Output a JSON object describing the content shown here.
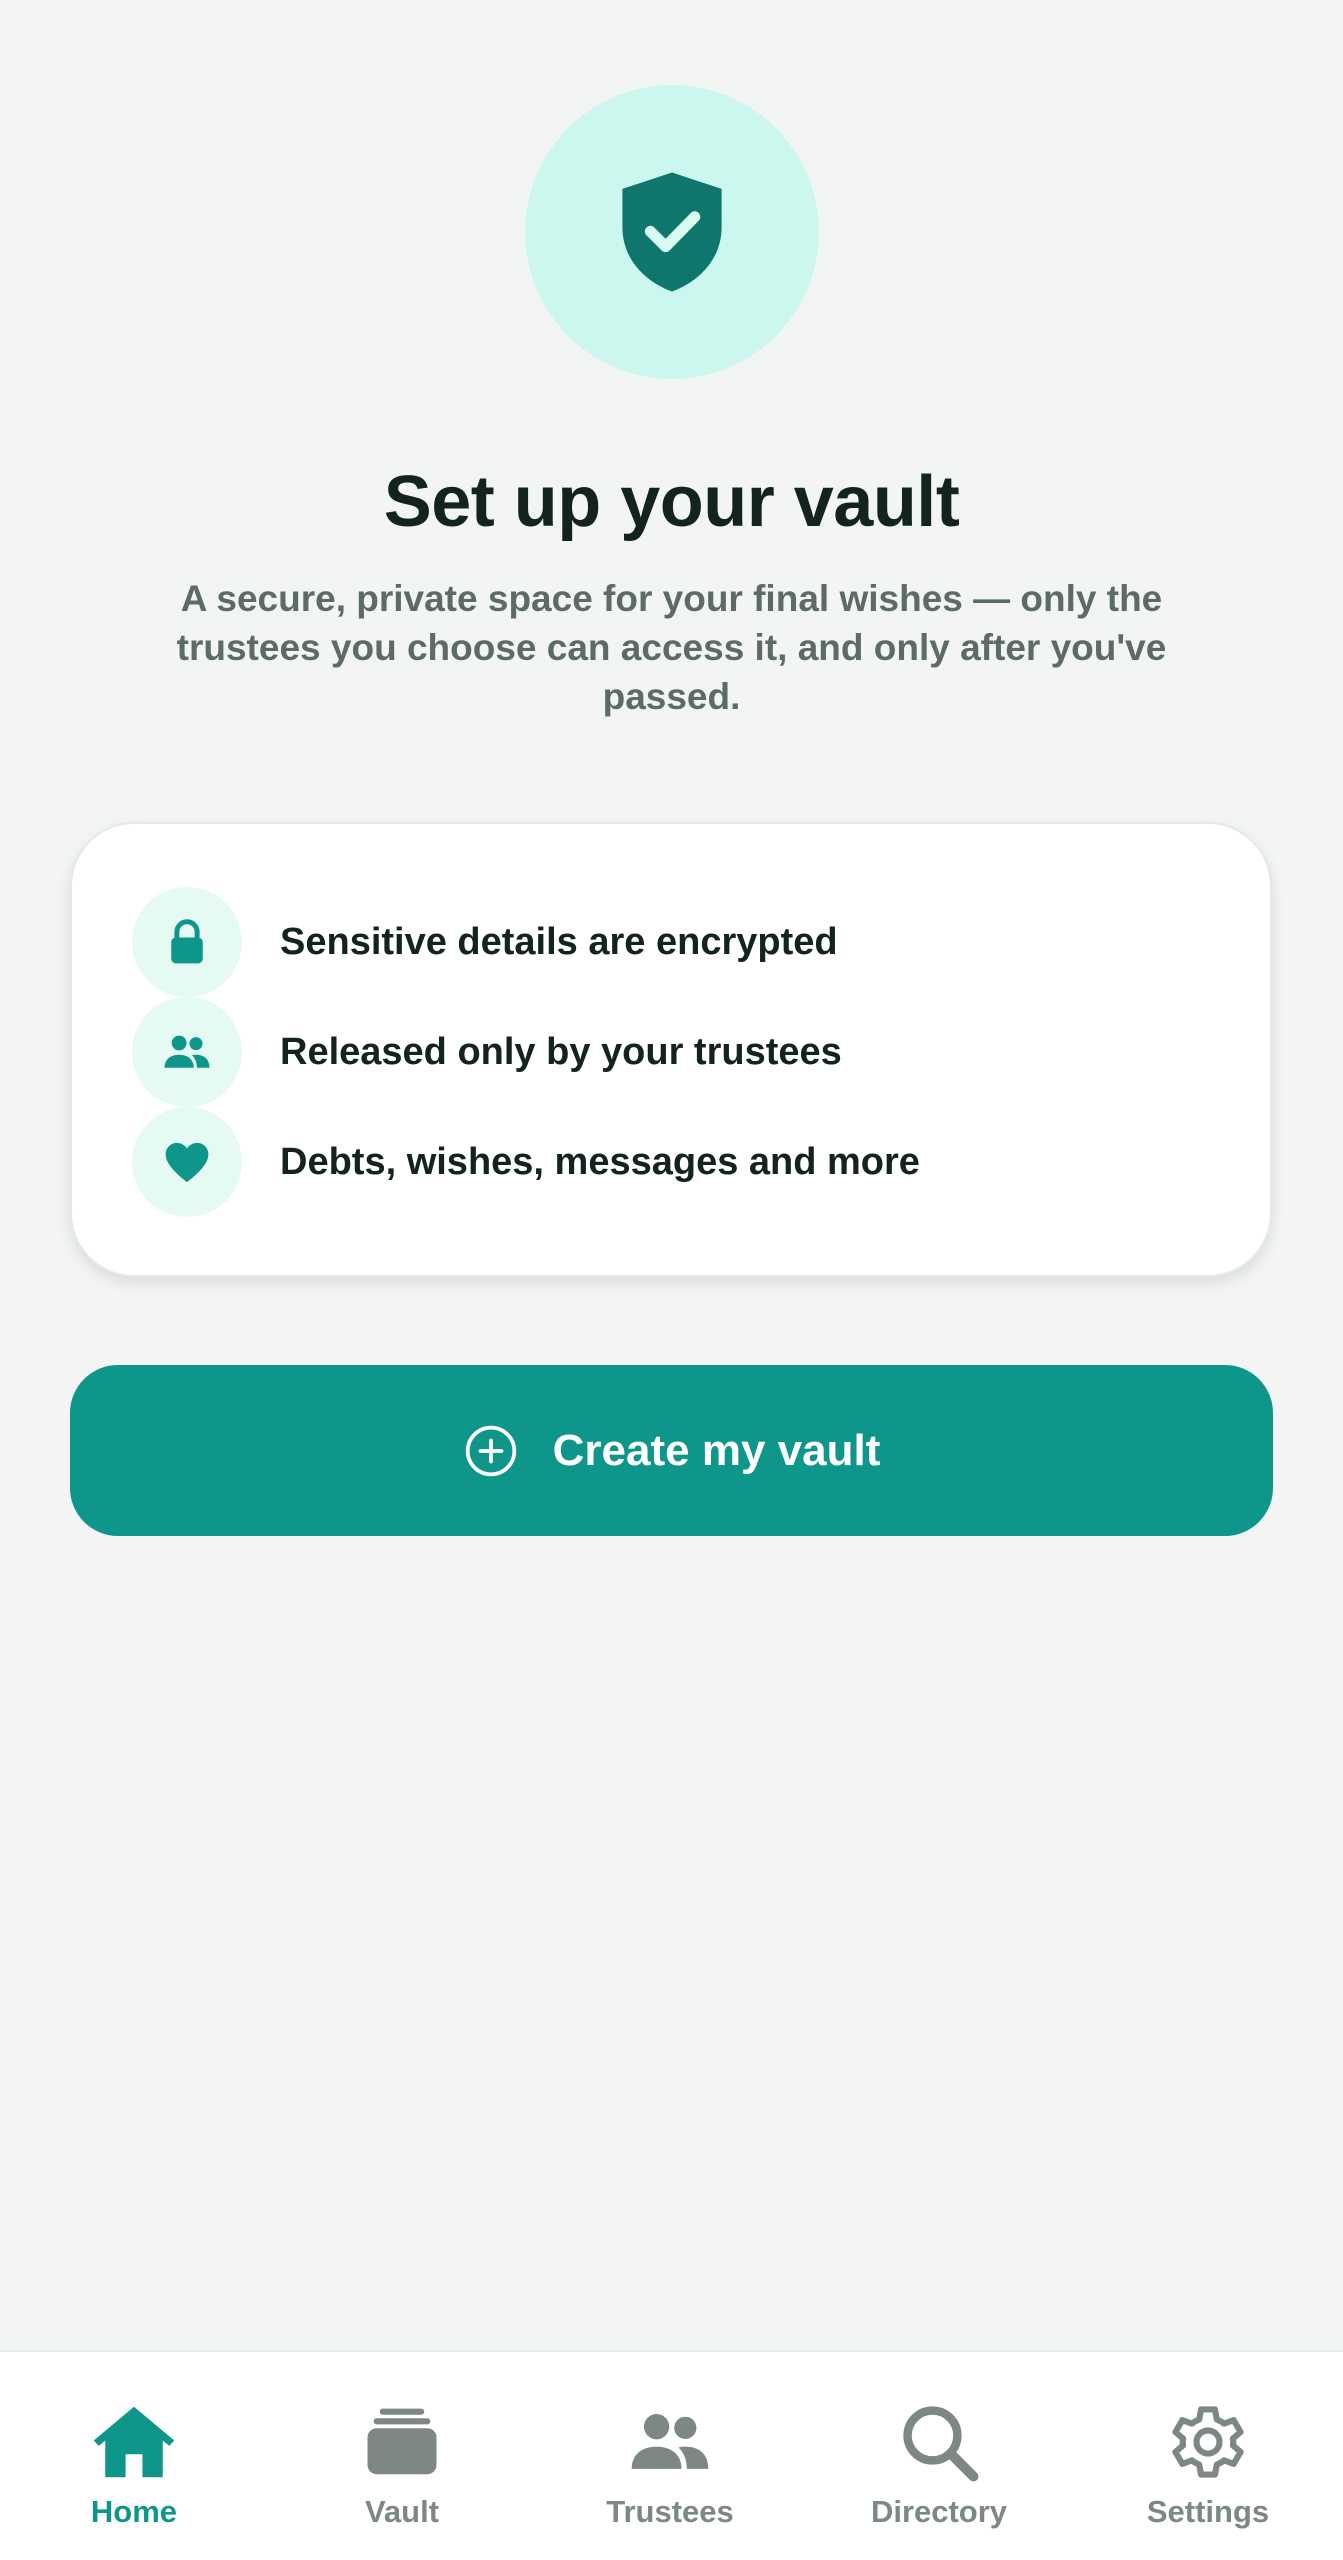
{
  "hero": {
    "icon": "shield-check-icon",
    "title": "Set up your vault",
    "subtitle": "A secure, private space for your final wishes — only the trustees you choose can access it, and only after you've passed."
  },
  "features": [
    {
      "icon": "lock-icon",
      "text": "Sensitive details are encrypted"
    },
    {
      "icon": "people-icon",
      "text": "Released only by your trustees"
    },
    {
      "icon": "heart-icon",
      "text": "Debts, wishes, messages and more"
    }
  ],
  "cta": {
    "icon": "plus-circle-icon",
    "label": "Create my vault"
  },
  "nav": {
    "active": "Home",
    "items": [
      {
        "icon": "home-icon",
        "label": "Home"
      },
      {
        "icon": "vault-stack-icon",
        "label": "Vault"
      },
      {
        "icon": "people-icon",
        "label": "Trustees"
      },
      {
        "icon": "search-icon",
        "label": "Directory"
      },
      {
        "icon": "gear-icon",
        "label": "Settings"
      }
    ]
  },
  "colors": {
    "background": "#f3f5f4",
    "accent": "#0f968a",
    "accent_dark": "#0f766e",
    "hero_circle": "#ccf7ee",
    "icon_circle": "#e6faf4",
    "text_primary": "#13231f",
    "text_secondary": "#5c6b68",
    "nav_inactive": "#7d8886"
  }
}
